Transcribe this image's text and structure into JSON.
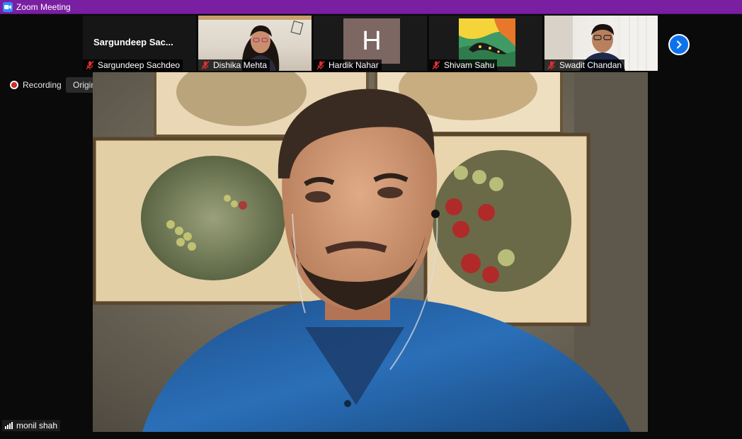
{
  "window": {
    "title": "Zoom Meeting"
  },
  "participants": [
    {
      "id": "sargundeep",
      "display_name": "Sargundeep  Sac...",
      "label": "Sargundeep Sachdeo",
      "muted": true,
      "video": false
    },
    {
      "id": "dishika",
      "label": "Dishika Mehta",
      "muted": true,
      "video": true
    },
    {
      "id": "hardik",
      "label": "Hardik Nahar",
      "avatar_letter": "H",
      "avatar_color": "#7d6762",
      "muted": true,
      "video": false
    },
    {
      "id": "shivam",
      "label": "Shivam Sahu",
      "muted": true,
      "video": false
    },
    {
      "id": "swadit",
      "label": "Swadit Chandan",
      "muted": true,
      "video": true
    }
  ],
  "controls": {
    "recording_label": "Recording",
    "original_sound_label": "Original Sound: Off"
  },
  "active_speaker": {
    "name": "monil shah"
  },
  "colors": {
    "titlebar": "#7a1fa2",
    "accent": "#0e72ed",
    "recording": "#e02828",
    "muted_mic": "#e03030"
  }
}
